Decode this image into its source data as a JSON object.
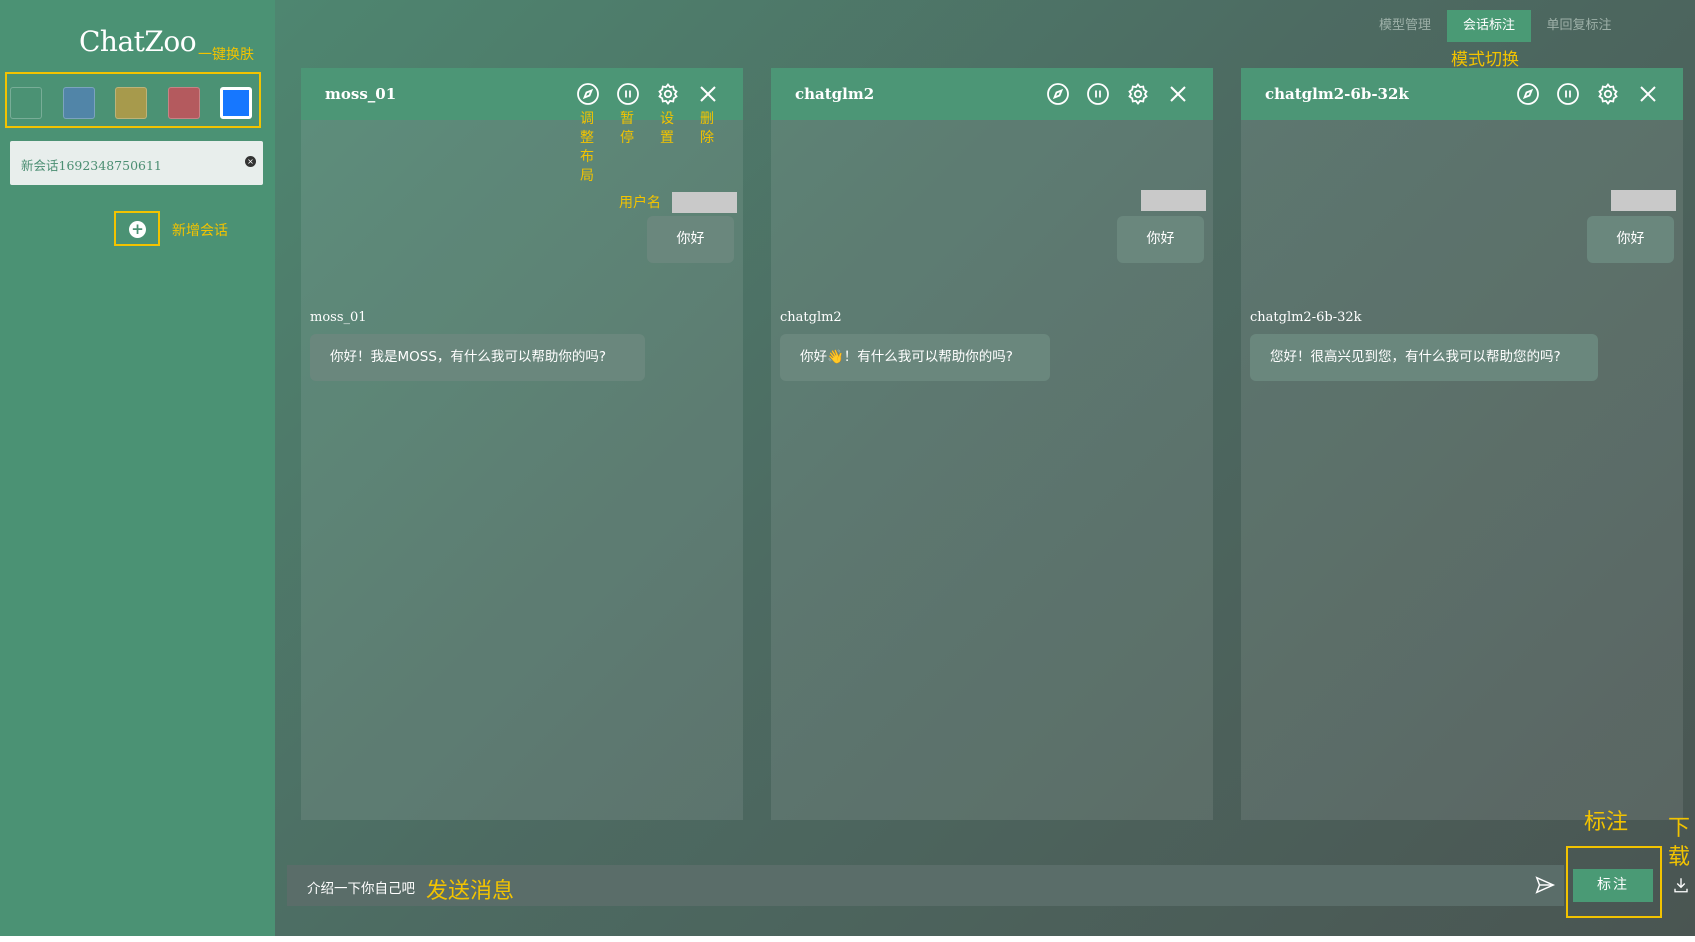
{
  "app": {
    "title": "ChatZoo",
    "annotation_skin": "一键换肤",
    "annotation_add_session": "新增会话",
    "annotation_mode_switch": "模式切换",
    "annotation_send": "发送消息",
    "annotation_label": "标注",
    "annotation_download": "下载"
  },
  "skins": {
    "colors": [
      "#4b9274",
      "#5185a8",
      "#a79a4c",
      "#b45a5e",
      "#1677ff"
    ],
    "selected_index": 4
  },
  "sessions": [
    {
      "label": "新会话1692348750611",
      "close_icon": "close-circle-icon"
    }
  ],
  "mode_tabs": [
    {
      "label": "模型管理",
      "active": false
    },
    {
      "label": "会话标注",
      "active": true
    },
    {
      "label": "单回复标注",
      "active": false
    }
  ],
  "header_icon_annotations": {
    "layout": "调\n整\n布\n局",
    "pause": "暂\n停",
    "settings": "设\n置",
    "delete": "删\n除",
    "username": "用户名"
  },
  "panels": [
    {
      "title": "moss_01",
      "user_message": "你好",
      "bot_name": "moss_01",
      "bot_message": "你好！我是MOSS，有什么我可以帮助你的吗?"
    },
    {
      "title": "chatglm2",
      "user_message": "你好",
      "bot_name": "chatglm2",
      "bot_message": "你好👋！有什么我可以帮助你的吗?"
    },
    {
      "title": "chatglm2-6b-32k",
      "user_message": "你好",
      "bot_name": "chatglm2-6b-32k",
      "bot_message": "您好！很高兴见到您，有什么我可以帮助您的吗?"
    }
  ],
  "input": {
    "value": "介绍一下你自己吧",
    "send_icon": "send-icon"
  },
  "actions": {
    "label_button": "标注",
    "download_icon": "download-icon"
  },
  "icons": {
    "header": [
      "compass-icon",
      "pause-icon",
      "gear-icon",
      "close-icon"
    ],
    "add_session": "plus-circle-icon"
  }
}
